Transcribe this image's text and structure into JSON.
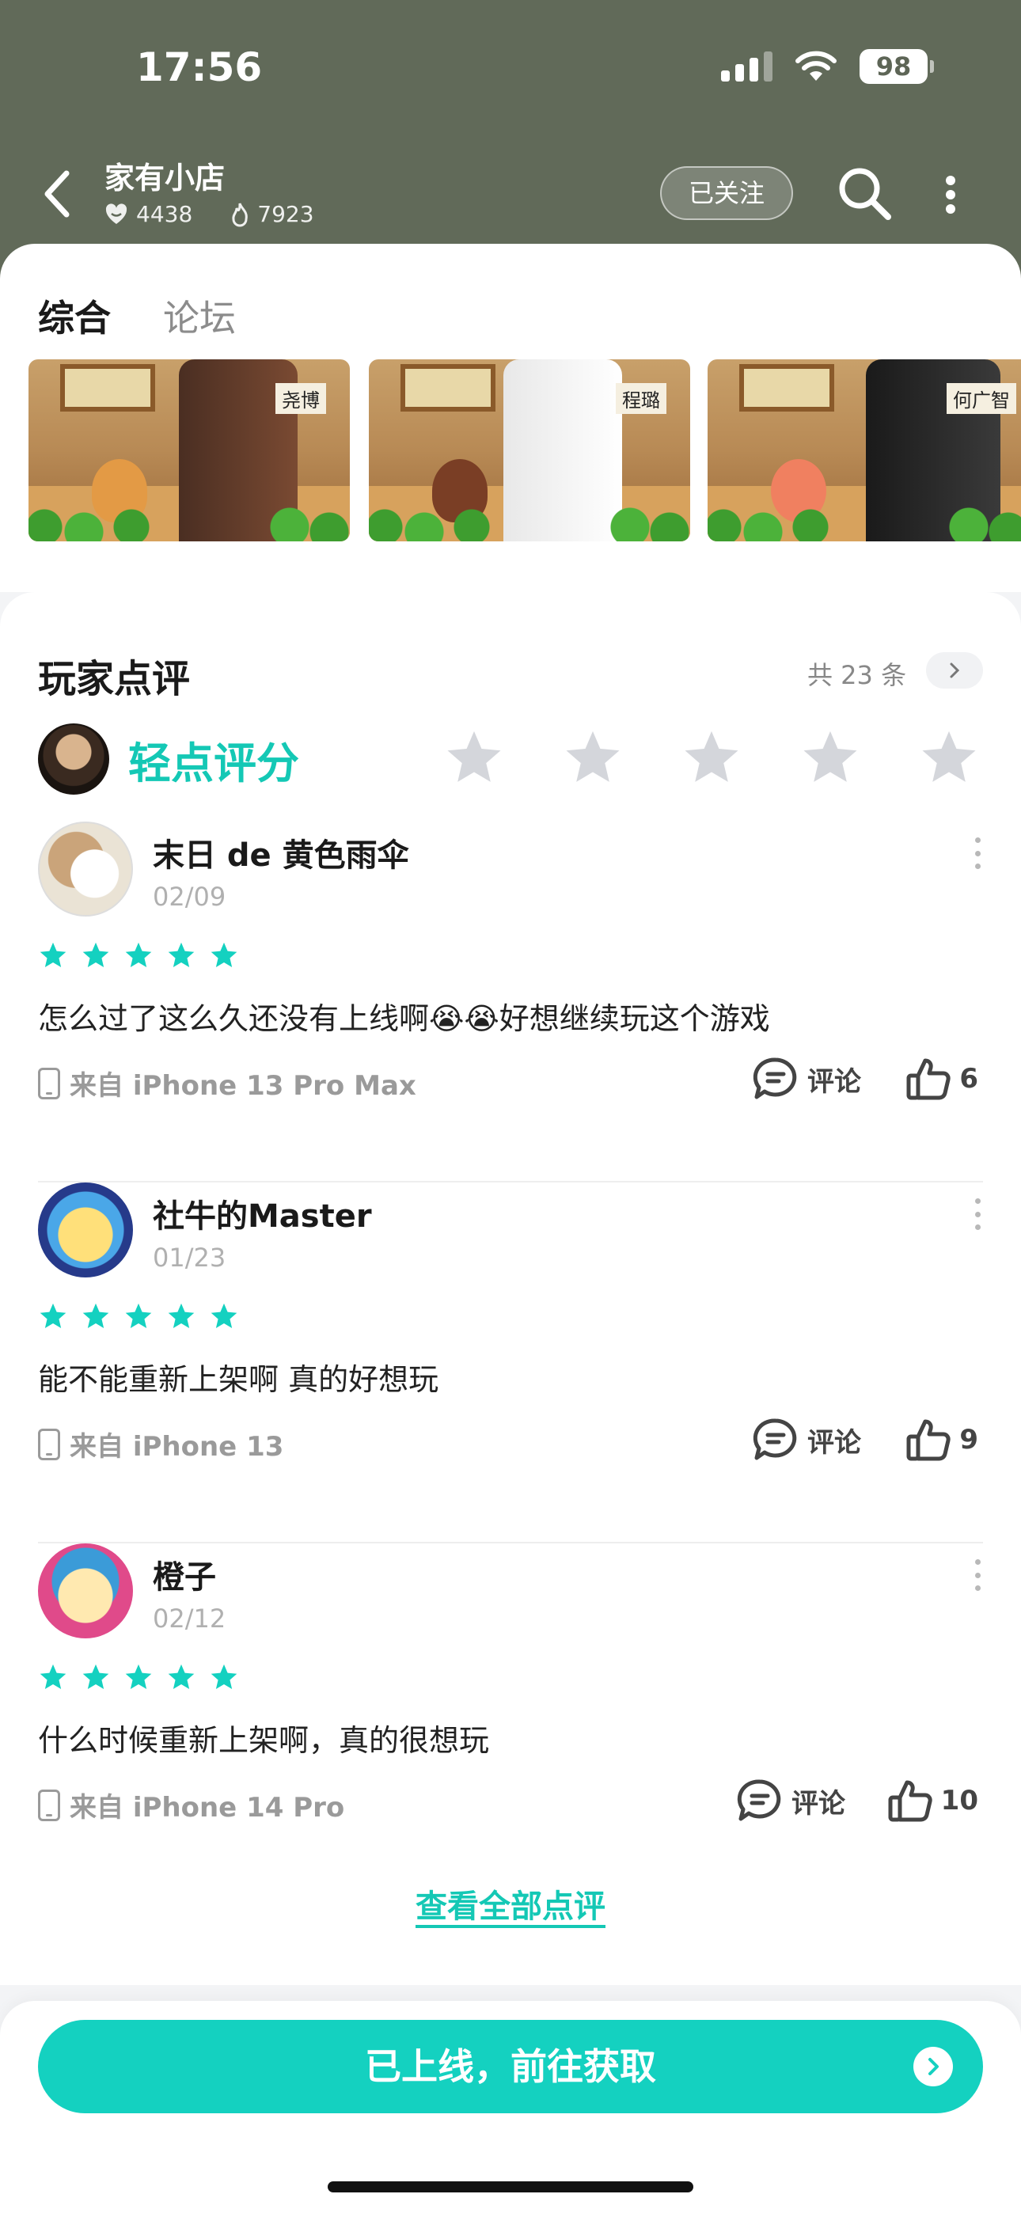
{
  "status_bar": {
    "time": "17:56",
    "battery": "98"
  },
  "header": {
    "shop_name": "家有小店",
    "likes": "4438",
    "heat": "7923",
    "follow_label": "已关注"
  },
  "tabs": [
    {
      "label": "综合",
      "active": true
    },
    {
      "label": "论坛",
      "active": false
    }
  ],
  "banners": [
    {
      "sign": "尧博"
    },
    {
      "sign": "程璐"
    },
    {
      "sign": "何广智"
    }
  ],
  "reviews_section": {
    "title": "玩家点评",
    "count_text": "共 23 条",
    "rate_label": "轻点评分",
    "see_all": "查看全部点评",
    "items": [
      {
        "name": "末日 de 黄色雨伞",
        "date": "02/09",
        "stars": 5,
        "text": "怎么过了这么久还没有上线啊😭😭好想继续玩这个游戏",
        "device": "来自 iPhone 13 Pro Max",
        "comment_label": "评论",
        "likes": "6"
      },
      {
        "name": "社牛的Master",
        "date": "01/23",
        "stars": 5,
        "text": "能不能重新上架啊 真的好想玩",
        "device": "来自 iPhone 13",
        "comment_label": "评论",
        "likes": "9"
      },
      {
        "name": "橙子",
        "date": "02/12",
        "stars": 5,
        "text": "什么时候重新上架啊，真的很想玩",
        "device": "来自 iPhone 14 Pro",
        "comment_label": "评论",
        "likes": "10"
      }
    ]
  },
  "cta": {
    "label": "已上线，前往获取"
  },
  "colors": {
    "accent": "#14d1c0",
    "header_bg": "#616a59",
    "star_empty": "#d4d6db"
  }
}
